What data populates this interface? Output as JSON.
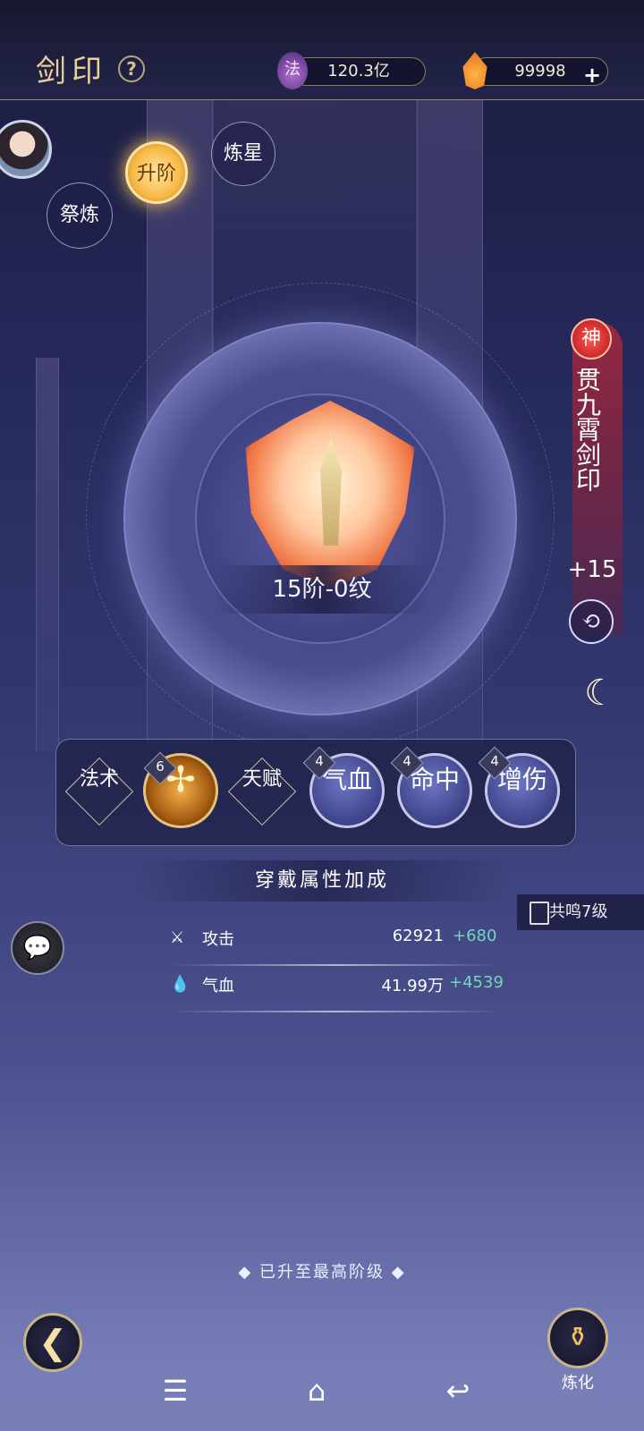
{
  "header": {
    "title": "剑印",
    "help_icon": "question-icon",
    "resources": [
      {
        "icon": "fa-currency-icon",
        "icon_char": "法",
        "value": "120.3亿"
      },
      {
        "icon": "flame-currency-icon",
        "value": "99998"
      }
    ],
    "add_label": "+"
  },
  "nodes": {
    "lianxing": "炼星",
    "shengjie": "升阶",
    "jilian": "祭炼"
  },
  "item": {
    "rank": "15阶-0纹",
    "tier_badge": "神",
    "name": "贯九霄剑印",
    "level": "+15",
    "swap_icon": "swap-icon",
    "next_icon": "crescent-icon"
  },
  "skills": [
    {
      "type": "diamond",
      "label": "法术"
    },
    {
      "type": "orb-gold",
      "label": "",
      "badge": "6"
    },
    {
      "type": "diamond",
      "label": "天赋"
    },
    {
      "type": "orb",
      "label": "气血",
      "badge": "4"
    },
    {
      "type": "orb",
      "label": "命中",
      "badge": "4"
    },
    {
      "type": "orb",
      "label": "增伤",
      "badge": "4"
    }
  ],
  "attributes": {
    "title": "穿戴属性加成",
    "resonance": "共鸣7级",
    "rows": [
      {
        "icon": "sword-icon",
        "label": "攻击",
        "value": "62921",
        "bonus": "+680"
      },
      {
        "icon": "drop-icon",
        "label": "气血",
        "value": "41.99万",
        "bonus": "+4539"
      }
    ]
  },
  "status": "已升至最高阶级",
  "footer": {
    "refine_label": "炼化"
  },
  "colors": {
    "accent_gold": "#e9cf95",
    "bonus_green": "#73d6b8",
    "tier_red": "#b3141a"
  }
}
